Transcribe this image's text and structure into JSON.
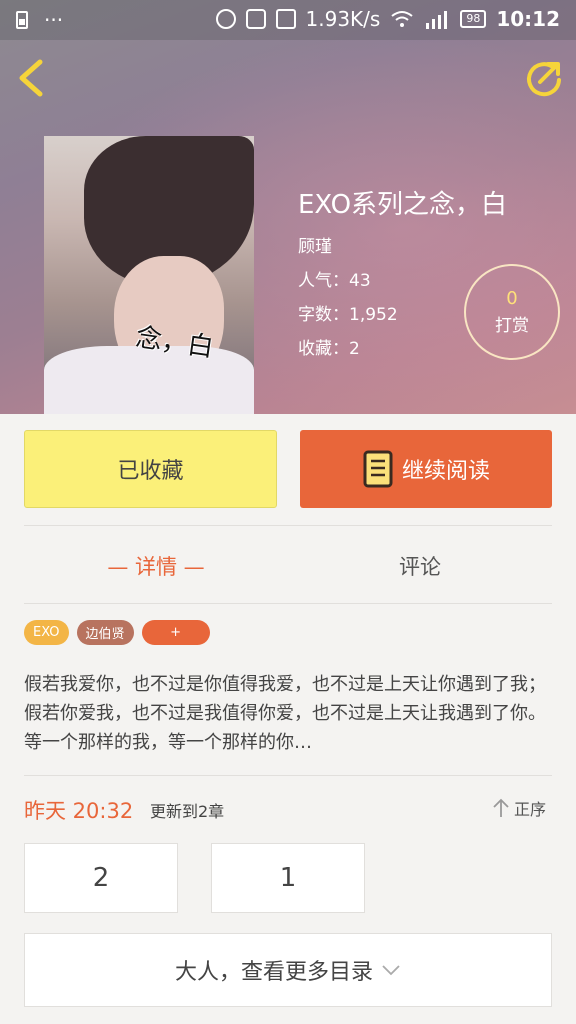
{
  "status_bar": {
    "left_icons": [
      "sim-icon",
      "more-dots"
    ],
    "network_speed": "1.93K/s",
    "battery": "98",
    "time": "10:12"
  },
  "nav": {
    "back_icon": "chevron-left-icon",
    "share_icon": "share-icon",
    "icon_color": "#f6d43a"
  },
  "book": {
    "cover_text": "念，白",
    "title": "EXO系列之念，白",
    "author": "顾瑾",
    "popularity": "人气：43",
    "word_count": "字数：1,952",
    "favorites": "收藏：2",
    "tip_count": "0",
    "tip_label": "打赏"
  },
  "actions": {
    "collected_label": "已收藏",
    "read_label": "继续阅读",
    "read_color": "#e8663a",
    "collected_color": "#fbf079"
  },
  "tabs": {
    "details": "— 详情 —",
    "comments": "评论"
  },
  "tags": [
    "EXO",
    "边伯贤",
    "+"
  ],
  "summary": "假若我爱你，也不过是你值得我爱，也不过是上天让你遇到了我；假若你爱我，也不过是我值得你爱，也不过是上天让我遇到了你。等一个那样的我，等一个那样的你…",
  "update": {
    "date": "昨天  20:32",
    "info": "更新到2章",
    "sort_label": "正序"
  },
  "chapters": [
    "2",
    "1"
  ],
  "more_label": "大人，查看更多目录"
}
